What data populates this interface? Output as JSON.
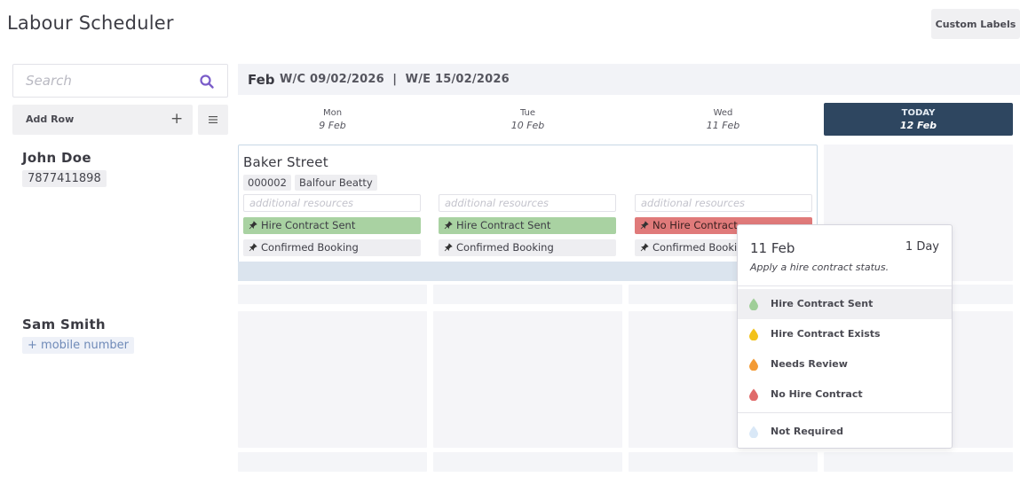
{
  "app": {
    "title": "Labour Scheduler",
    "custom_labels_button": "Custom Labels"
  },
  "search": {
    "placeholder": "Search",
    "value": ""
  },
  "sidebar": {
    "add_row_label": "Add Row",
    "add_icon": "plus-icon",
    "menu_icon": "menu-icon"
  },
  "week": {
    "month": "Feb",
    "range": "W/C 09/02/2026  |  W/E 15/02/2026"
  },
  "days": [
    {
      "name": "Mon",
      "date": "9 Feb"
    },
    {
      "name": "Tue",
      "date": "10 Feb"
    },
    {
      "name": "Wed",
      "date": "11 Feb"
    },
    {
      "name": "TODAY",
      "date": "12 Feb"
    }
  ],
  "rows": [
    {
      "name": "John Doe",
      "phone": "7877411898"
    },
    {
      "name": "Sam Smith",
      "phone_placeholder": "+ mobile number"
    }
  ],
  "job": {
    "title": "Baker Street",
    "chips": [
      "000002",
      "Balfour Beatty"
    ],
    "resource_placeholder": "additional resources",
    "statuses": [
      "Hire Contract Sent",
      "Hire Contract Sent",
      "No Hire Contract"
    ],
    "bookings": [
      "Confirmed Booking",
      "Confirmed Booking",
      "Confirmed Booking"
    ]
  },
  "popover": {
    "date": "11 Feb",
    "duration": "1 Day",
    "hint": "Apply a hire contract status.",
    "options": [
      {
        "label": "Hire Contract Sent",
        "color": "#9fce98"
      },
      {
        "label": "Hire Contract Exists",
        "color": "#f2c21b"
      },
      {
        "label": "Needs Review",
        "color": "#f39a35"
      },
      {
        "label": "No Hire Contract",
        "color": "#e06a6a"
      },
      {
        "label": "Not Required",
        "color": "#d9e8f7"
      }
    ]
  },
  "colors": {
    "accent": "#7a5cc9",
    "today": "#2e4660",
    "status_green": "#a9d2a2",
    "status_red": "#e07a7a"
  }
}
